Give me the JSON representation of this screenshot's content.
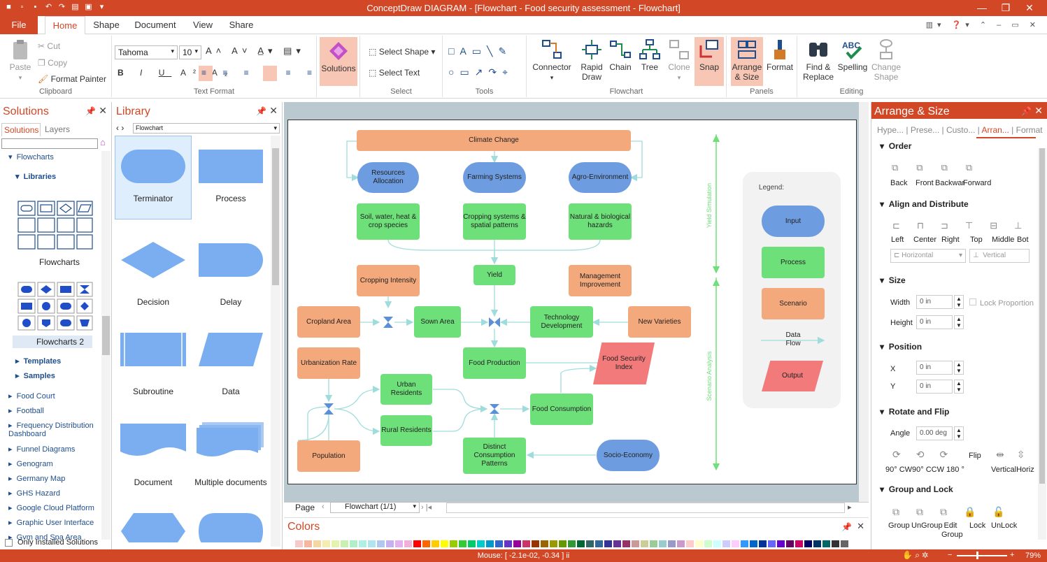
{
  "app": {
    "title": "ConceptDraw DIAGRAM - [Flowchart - Food security assessment - Flowchart]"
  },
  "ribbon_tabs": {
    "file": "File",
    "home": "Home",
    "shape": "Shape",
    "document": "Document",
    "view": "View",
    "share": "Share"
  },
  "clipboard": {
    "paste": "Paste",
    "cut": "Cut",
    "copy": "Copy",
    "format_painter": "Format Painter",
    "label": "Clipboard"
  },
  "text_format": {
    "font": "Tahoma",
    "size": "10",
    "label": "Text Format"
  },
  "solutions_btn": {
    "label": "Solutions"
  },
  "select": {
    "select_shape": "Select Shape",
    "select_text": "Select Text",
    "label": "Select"
  },
  "tools": {
    "label": "Tools"
  },
  "flowchart_grp": {
    "connector": "Connector",
    "rapid_draw": "Rapid Draw",
    "chain": "Chain",
    "tree": "Tree",
    "clone": "Clone",
    "snap": "Snap",
    "label": "Flowchart"
  },
  "panels_grp": {
    "arrange_size": "Arrange & Size",
    "format": "Format",
    "label": "Panels"
  },
  "editing_grp": {
    "find_replace": "Find & Replace",
    "spelling": "Spelling",
    "change_shape": "Change Shape",
    "label": "Editing"
  },
  "solutions_panel": {
    "title": "Solutions",
    "tab_solutions": "Solutions",
    "tab_layers": "Layers",
    "flowcharts": "Flowcharts",
    "libraries": "Libraries",
    "lib1": "Flowcharts",
    "lib2": "Flowcharts 2",
    "templates": "Templates",
    "samples": "Samples",
    "items": [
      "Food Court",
      "Football",
      "Frequency Distribution Dashboard",
      "Funnel Diagrams",
      "Genogram",
      "Germany Map",
      "GHS Hazard",
      "Google Cloud Platform",
      "Graphic User Interface",
      "Gym and Spa Area"
    ],
    "only_installed": "Only Installed Solutions"
  },
  "library_panel": {
    "title": "Library",
    "selected": "Flowchart",
    "shapes": [
      "Terminator",
      "Process",
      "Decision",
      "Delay",
      "Subroutine",
      "Data",
      "Document",
      "Multiple documents"
    ]
  },
  "diagram": {
    "climate_change": "Climate Change",
    "resources_allocation": "Resources Allocation",
    "farming_systems": "Farming Systems",
    "agro_environment": "Agro-Environment",
    "soil": "Soil, water, heat & crop species",
    "cropping_systems": "Cropping systems & spatial patterns",
    "natural_hazards": "Natural & biological hazards",
    "cropping_intensity": "Cropping Intensity",
    "yield": "Yield",
    "management_improvement": "Management Improvement",
    "cropland_area": "Cropland Area",
    "sown_area": "Sown Area",
    "technology_development": "Technology Development",
    "new_varieties": "New Varieties",
    "urbanization_rate": "Urbanization Rate",
    "food_production": "Food Production",
    "food_security_index": "Food Security Index",
    "urban_residents": "Urban Residents",
    "rural_residents": "Rural Residents",
    "food_consumption": "Food Consumption",
    "population": "Population",
    "distinct_consumption": "Distinct Consumption Patterns",
    "socio_economy": "Socio-Economy",
    "yield_simulation": "Yield Simulation",
    "scenario_analysis": "Scenario Analysis",
    "legend_title": "Legend:",
    "legend_input": "Input",
    "legend_process": "Process",
    "legend_scenario": "Scenario",
    "legend_data_flow": "Data Flow",
    "legend_output": "Output"
  },
  "page_nav": {
    "page_label": "Page",
    "page_select": "Flowchart (1/1)"
  },
  "colors_panel": {
    "title": "Colors"
  },
  "arrange_panel": {
    "title": "Arrange & Size",
    "tabs": [
      "Hype...",
      "Prese...",
      "Custo...",
      "Arran...",
      "Format"
    ],
    "order": "Order",
    "order_btns": [
      "Back",
      "Front",
      "Backwar",
      "Forward"
    ],
    "align": "Align and Distribute",
    "align_btns": [
      "Left",
      "Center",
      "Right",
      "Top",
      "Middle",
      "Bot"
    ],
    "horizontal": "Horizontal",
    "vertical": "Vertical",
    "size": "Size",
    "width_label": "Width",
    "width_val": "0 in",
    "height_label": "Height",
    "height_val": "0 in",
    "lock_proportion": "Lock Proportion",
    "position": "Position",
    "x_label": "X",
    "x_val": "0 in",
    "y_label": "Y",
    "y_val": "0 in",
    "rotate": "Rotate and Flip",
    "angle_label": "Angle",
    "angle_val": "0.00 deg",
    "rotate_btns": "90° CW90° CCW 180 °",
    "flip": "Flip",
    "flip_btns": "VerticalHoriz",
    "group_lock": "Group and Lock",
    "group_btns": [
      "Group",
      "UnGroup",
      "Edit Group",
      "Lock",
      "UnLock"
    ]
  },
  "status": {
    "mouse": "Mouse: [ -2.1e-02, -0.34 ] ii",
    "zoom": "79%"
  },
  "colors": {
    "accent": "#d24726",
    "input": "#6d9de0",
    "process": "#6ee07a",
    "scenario": "#f4a97c",
    "output": "#f27a7a",
    "flow": "#9fdcdc"
  }
}
